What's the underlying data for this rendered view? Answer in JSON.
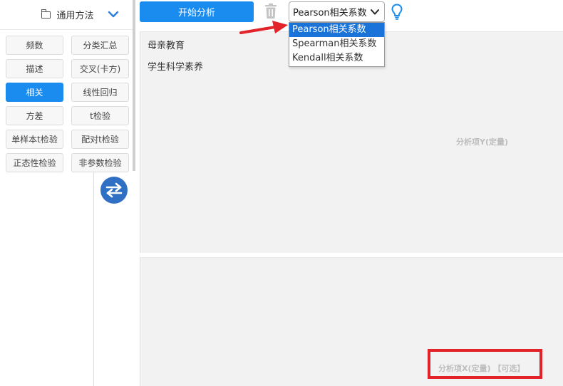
{
  "toolbar": {
    "start_label": "开始分析",
    "trash_icon": "trash-icon",
    "bulb_icon": "lightbulb-icon",
    "select_value": "Pearson相关系数",
    "select_options": [
      "Pearson相关系数",
      "Spearman相关系数",
      "Kendall相关系数"
    ],
    "selected_index": 0
  },
  "sidebar": {
    "category_label": "通用方法",
    "methods": [
      {
        "label": "频数"
      },
      {
        "label": "分类汇总"
      },
      {
        "label": "描述"
      },
      {
        "label": "交叉(卡方)"
      },
      {
        "label": "相关",
        "active": true
      },
      {
        "label": "线性回归"
      },
      {
        "label": "方差"
      },
      {
        "label": "t检验"
      },
      {
        "label": "单样本t检验"
      },
      {
        "label": "配对t检验"
      },
      {
        "label": "正态性检验"
      },
      {
        "label": "非参数检验"
      }
    ]
  },
  "panel_y": {
    "items": [
      "母亲教育",
      "学生科学素养"
    ],
    "placeholder": "分析项Y(定量)"
  },
  "panel_x": {
    "placeholder": "分析项X(定量) 【可选】"
  },
  "colors": {
    "accent": "#1a8cf0",
    "selected_option": "#1a73d8",
    "swap_button": "#2f6fc4",
    "annotation_red": "#e2232a"
  }
}
